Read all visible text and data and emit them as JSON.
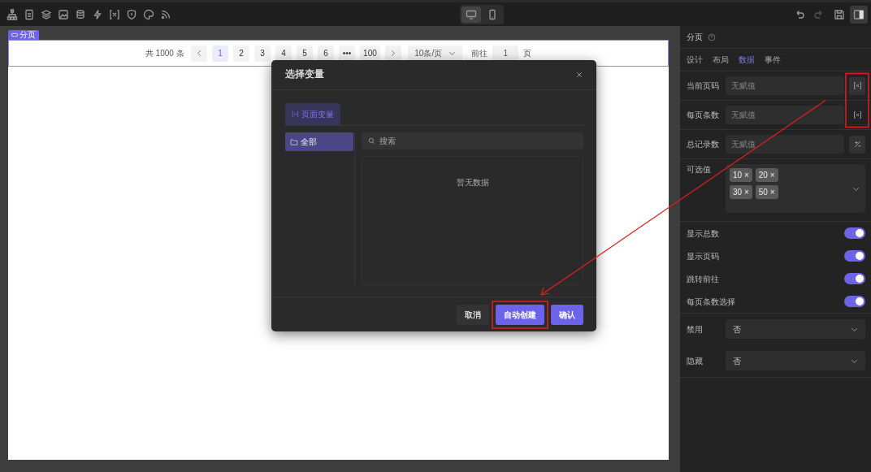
{
  "toolbar": {
    "devices": [
      {
        "kind": "desktop",
        "selected": true
      },
      {
        "kind": "mobile",
        "selected": false
      }
    ],
    "right_icons": [
      {
        "kind": "undo",
        "disabled": false
      },
      {
        "kind": "redo",
        "disabled": true
      },
      {
        "kind": "save",
        "disabled": false
      },
      {
        "kind": "panel",
        "disabled": false
      }
    ]
  },
  "canvas": {
    "component_tag": "分页",
    "pagination": {
      "total": "共 1000 条",
      "pages": [
        {
          "label": "1",
          "selected": true
        },
        {
          "label": "2",
          "selected": false
        },
        {
          "label": "3",
          "selected": false
        },
        {
          "label": "4",
          "selected": false
        },
        {
          "label": "5",
          "selected": false
        },
        {
          "label": "6",
          "selected": false
        },
        {
          "label": "•••",
          "selected": false
        },
        {
          "label": "100",
          "selected": false
        }
      ],
      "page_size": "10条/页",
      "goto_label": "前往",
      "goto_value": "1",
      "goto_suffix": "页"
    }
  },
  "dialog": {
    "title": "选择变量",
    "tabs": [
      {
        "label": "页面变量",
        "selected": true
      }
    ],
    "groups": [
      {
        "label": "全部",
        "selected": true
      }
    ],
    "search": {
      "placeholder": "搜索"
    },
    "empty_text": "暂无数据",
    "buttons": [
      {
        "label": "取消",
        "kind": "secondary"
      },
      {
        "label": "自动创建",
        "kind": "primary"
      },
      {
        "label": "确认",
        "kind": "primary"
      }
    ]
  },
  "panel": {
    "title": "分页",
    "tabs": [
      {
        "label": "设计",
        "selected": false
      },
      {
        "label": "布局",
        "selected": false
      },
      {
        "label": "数据",
        "selected": true
      },
      {
        "label": "事件",
        "selected": false
      }
    ],
    "fields": [
      {
        "kind": "input",
        "label": "当前页码",
        "placeholder": "无赋值",
        "button": {
          "kind": "variable"
        }
      },
      {
        "kind": "input",
        "label": "每页条数",
        "placeholder": "无赋值",
        "button": {
          "kind": "variable"
        }
      },
      {
        "kind": "input",
        "label": "总记录数",
        "placeholder": "无赋值",
        "button": {
          "kind": "expression"
        }
      },
      {
        "kind": "tags",
        "label": "可选值",
        "tags": [
          "10 ×",
          "20 ×",
          "30 ×",
          "50 ×"
        ]
      },
      {
        "kind": "switch",
        "label": "显示总数",
        "on": true
      },
      {
        "kind": "switch",
        "label": "显示页码",
        "on": true
      },
      {
        "kind": "switch",
        "label": "跳转前往",
        "on": true
      },
      {
        "kind": "switch",
        "label": "每页条数选择",
        "on": true
      },
      {
        "kind": "select",
        "label": "禁用",
        "value": "否"
      },
      {
        "kind": "select",
        "label": "隐藏",
        "value": "否"
      }
    ]
  }
}
